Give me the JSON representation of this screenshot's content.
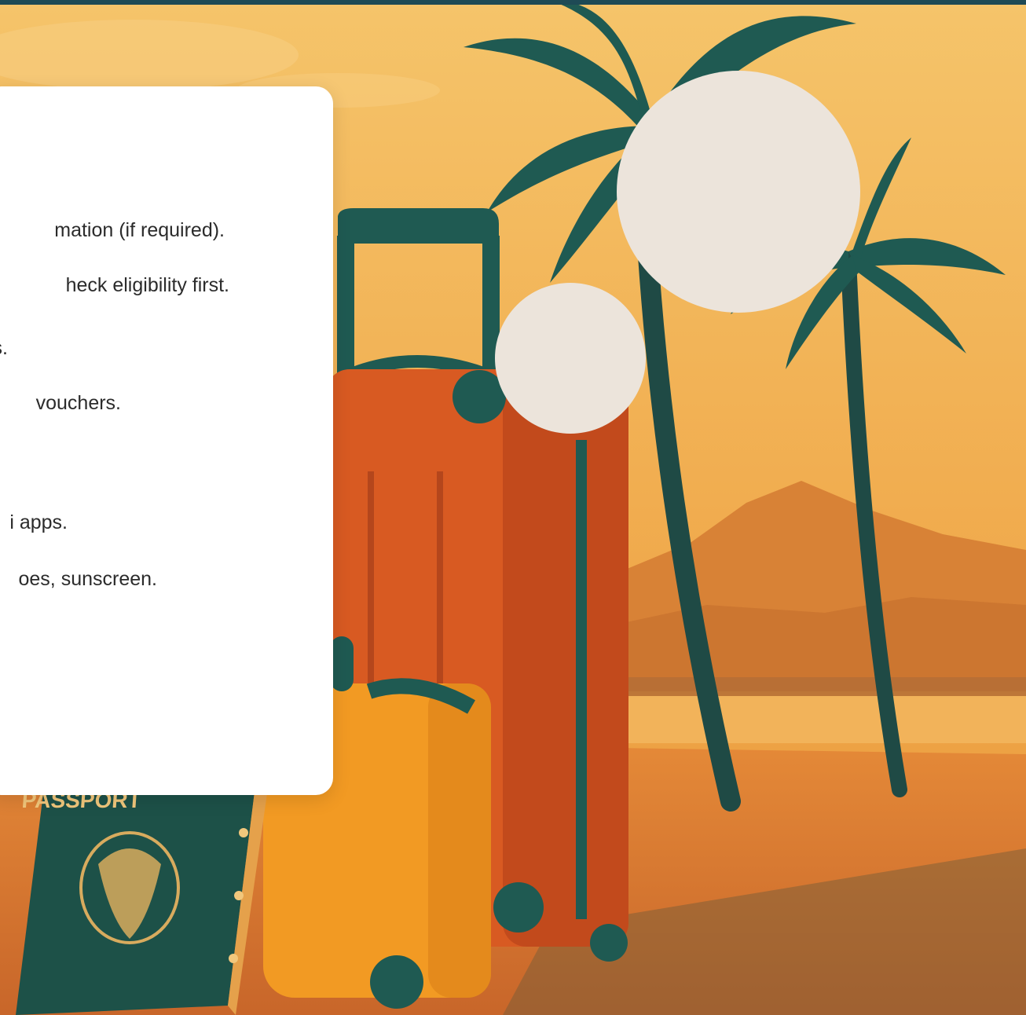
{
  "colors": {
    "top_strip": "#1e4a55",
    "card_background": "#ffffff",
    "bubble": "#ece4db",
    "sky": "#f0b45a",
    "sand": "#d9742d",
    "teal": "#1f5a52"
  },
  "checklist": {
    "items": [
      {
        "text": "mation (if required)."
      },
      {
        "text": "heck eligibility first."
      },
      {
        "text": "s."
      },
      {
        "text": "vouchers."
      },
      {
        "text": "i apps."
      },
      {
        "text": "oes, sunscreen."
      }
    ]
  },
  "scene": {
    "passport_label": "PASSPORT"
  },
  "icons": {
    "palm_tree": "palm-tree-icon",
    "suitcase": "suitcase-icon",
    "passport": "passport-icon"
  }
}
